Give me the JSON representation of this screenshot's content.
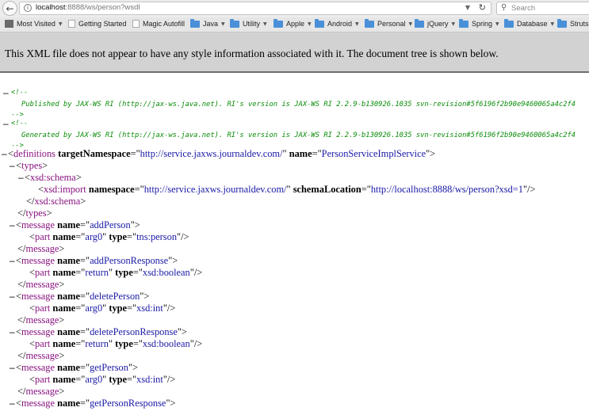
{
  "toolbar": {
    "url_host": "localhost",
    "url_path": ":8888/ws/person?wsdl",
    "search_placeholder": "Search"
  },
  "bookmarks": [
    {
      "label": "Most Visited",
      "type": "special",
      "caret": true
    },
    {
      "label": "Getting Started",
      "type": "page",
      "caret": false
    },
    {
      "label": "Magic Autofill",
      "type": "page",
      "caret": false
    },
    {
      "label": "Java",
      "type": "folder",
      "caret": true
    },
    {
      "label": "Utility",
      "type": "folder",
      "caret": true
    },
    {
      "label": "Apple",
      "type": "folder",
      "caret": true
    },
    {
      "label": "Android",
      "type": "folder",
      "caret": true
    },
    {
      "label": "Personal",
      "type": "folder",
      "caret": true
    },
    {
      "label": "jQuery",
      "type": "folder",
      "caret": true
    },
    {
      "label": "Spring",
      "type": "folder",
      "caret": true
    },
    {
      "label": "Database",
      "type": "folder",
      "caret": true
    },
    {
      "label": "Struts",
      "type": "folder",
      "caret": false
    }
  ],
  "banner": {
    "text": "This XML file does not appear to have any style information associated with it. The document tree is shown below."
  },
  "xml": {
    "comment1_open": "<!--",
    "comment1_text": "Published by JAX-WS RI (http://jax-ws.java.net). RI's version is JAX-WS RI 2.2.9-b130926.1035 svn-revision#5f6196f2b90e9460065a4c2f4",
    "comment_close": "-->",
    "comment2_text": "Generated by JAX-WS RI (http://jax-ws.java.net). RI's version is JAX-WS RI 2.2.9-b130926.1035 svn-revision#5f6196f2b90e9460065a4c2f4",
    "definitions": {
      "tag": "definitions",
      "attr1": "targetNamespace",
      "val1": "http://service.jaxws.journaldev.com/",
      "attr2": "name",
      "val2": "PersonServiceImplService"
    },
    "types_tag": "types",
    "schema_tag": "xsd:schema",
    "import": {
      "tag": "xsd:import",
      "attr1": "namespace",
      "val1": "http://service.jaxws.journaldev.com/",
      "attr2": "schemaLocation",
      "val2": "http://localhost:8888/ws/person?xsd=1"
    },
    "message_tag": "message",
    "part_tag": "part",
    "name_attr": "name",
    "type_attr": "type",
    "messages": [
      {
        "name": "addPerson",
        "part_name": "arg0",
        "part_type": "tns:person"
      },
      {
        "name": "addPersonResponse",
        "part_name": "return",
        "part_type": "xsd:boolean"
      },
      {
        "name": "deletePerson",
        "part_name": "arg0",
        "part_type": "xsd:int"
      },
      {
        "name": "deletePersonResponse",
        "part_name": "return",
        "part_type": "xsd:boolean"
      },
      {
        "name": "getPerson",
        "part_name": "arg0",
        "part_type": "xsd:int"
      },
      {
        "name": "getPersonResponse"
      }
    ]
  }
}
